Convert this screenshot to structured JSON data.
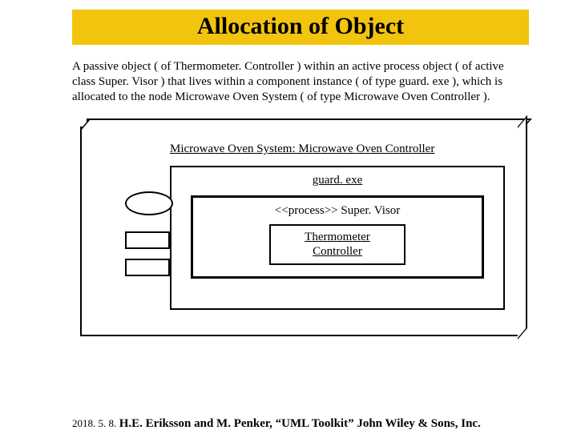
{
  "title": "Allocation of Object",
  "paragraph": "A passive object ( of Thermometer. Controller ) within an active process object ( of active class Super. Visor ) that lives within a component instance ( of type guard. exe ), which is allocated to the node Microwave Oven System  ( of type Microwave Oven Controller ).",
  "diagram": {
    "node_label": "Microwave Oven System: Microwave Oven Controller",
    "component_label": "guard. exe",
    "process_label": "<<process>> Super. Visor",
    "passive_object_line1": "Thermometer",
    "passive_object_line2": "Controller"
  },
  "footer": {
    "date": "2018. 5. 8.",
    "reference": "H.E. Eriksson and M. Penker, “UML Toolkit” John Wiley & Sons, Inc."
  }
}
